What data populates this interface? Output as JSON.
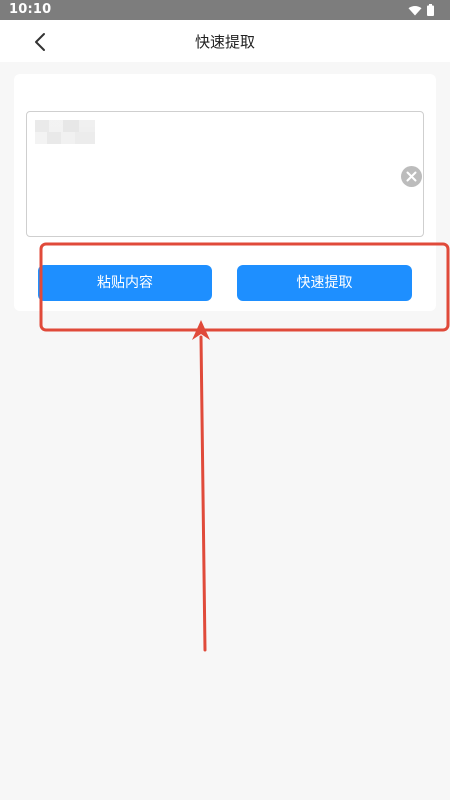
{
  "status_bar": {
    "time": "10:10",
    "icons": [
      "wifi-icon",
      "battery-icon"
    ]
  },
  "header": {
    "back_icon": "chevron-left-icon",
    "title": "快速提取"
  },
  "input": {
    "value": "",
    "clear_icon": "close-circle-icon"
  },
  "actions": {
    "paste_label": "粘贴内容",
    "extract_label": "快速提取"
  },
  "colors": {
    "accent": "#1e8fff",
    "annotation": "#e04a3a",
    "status_bar": "#7d7d7d"
  }
}
